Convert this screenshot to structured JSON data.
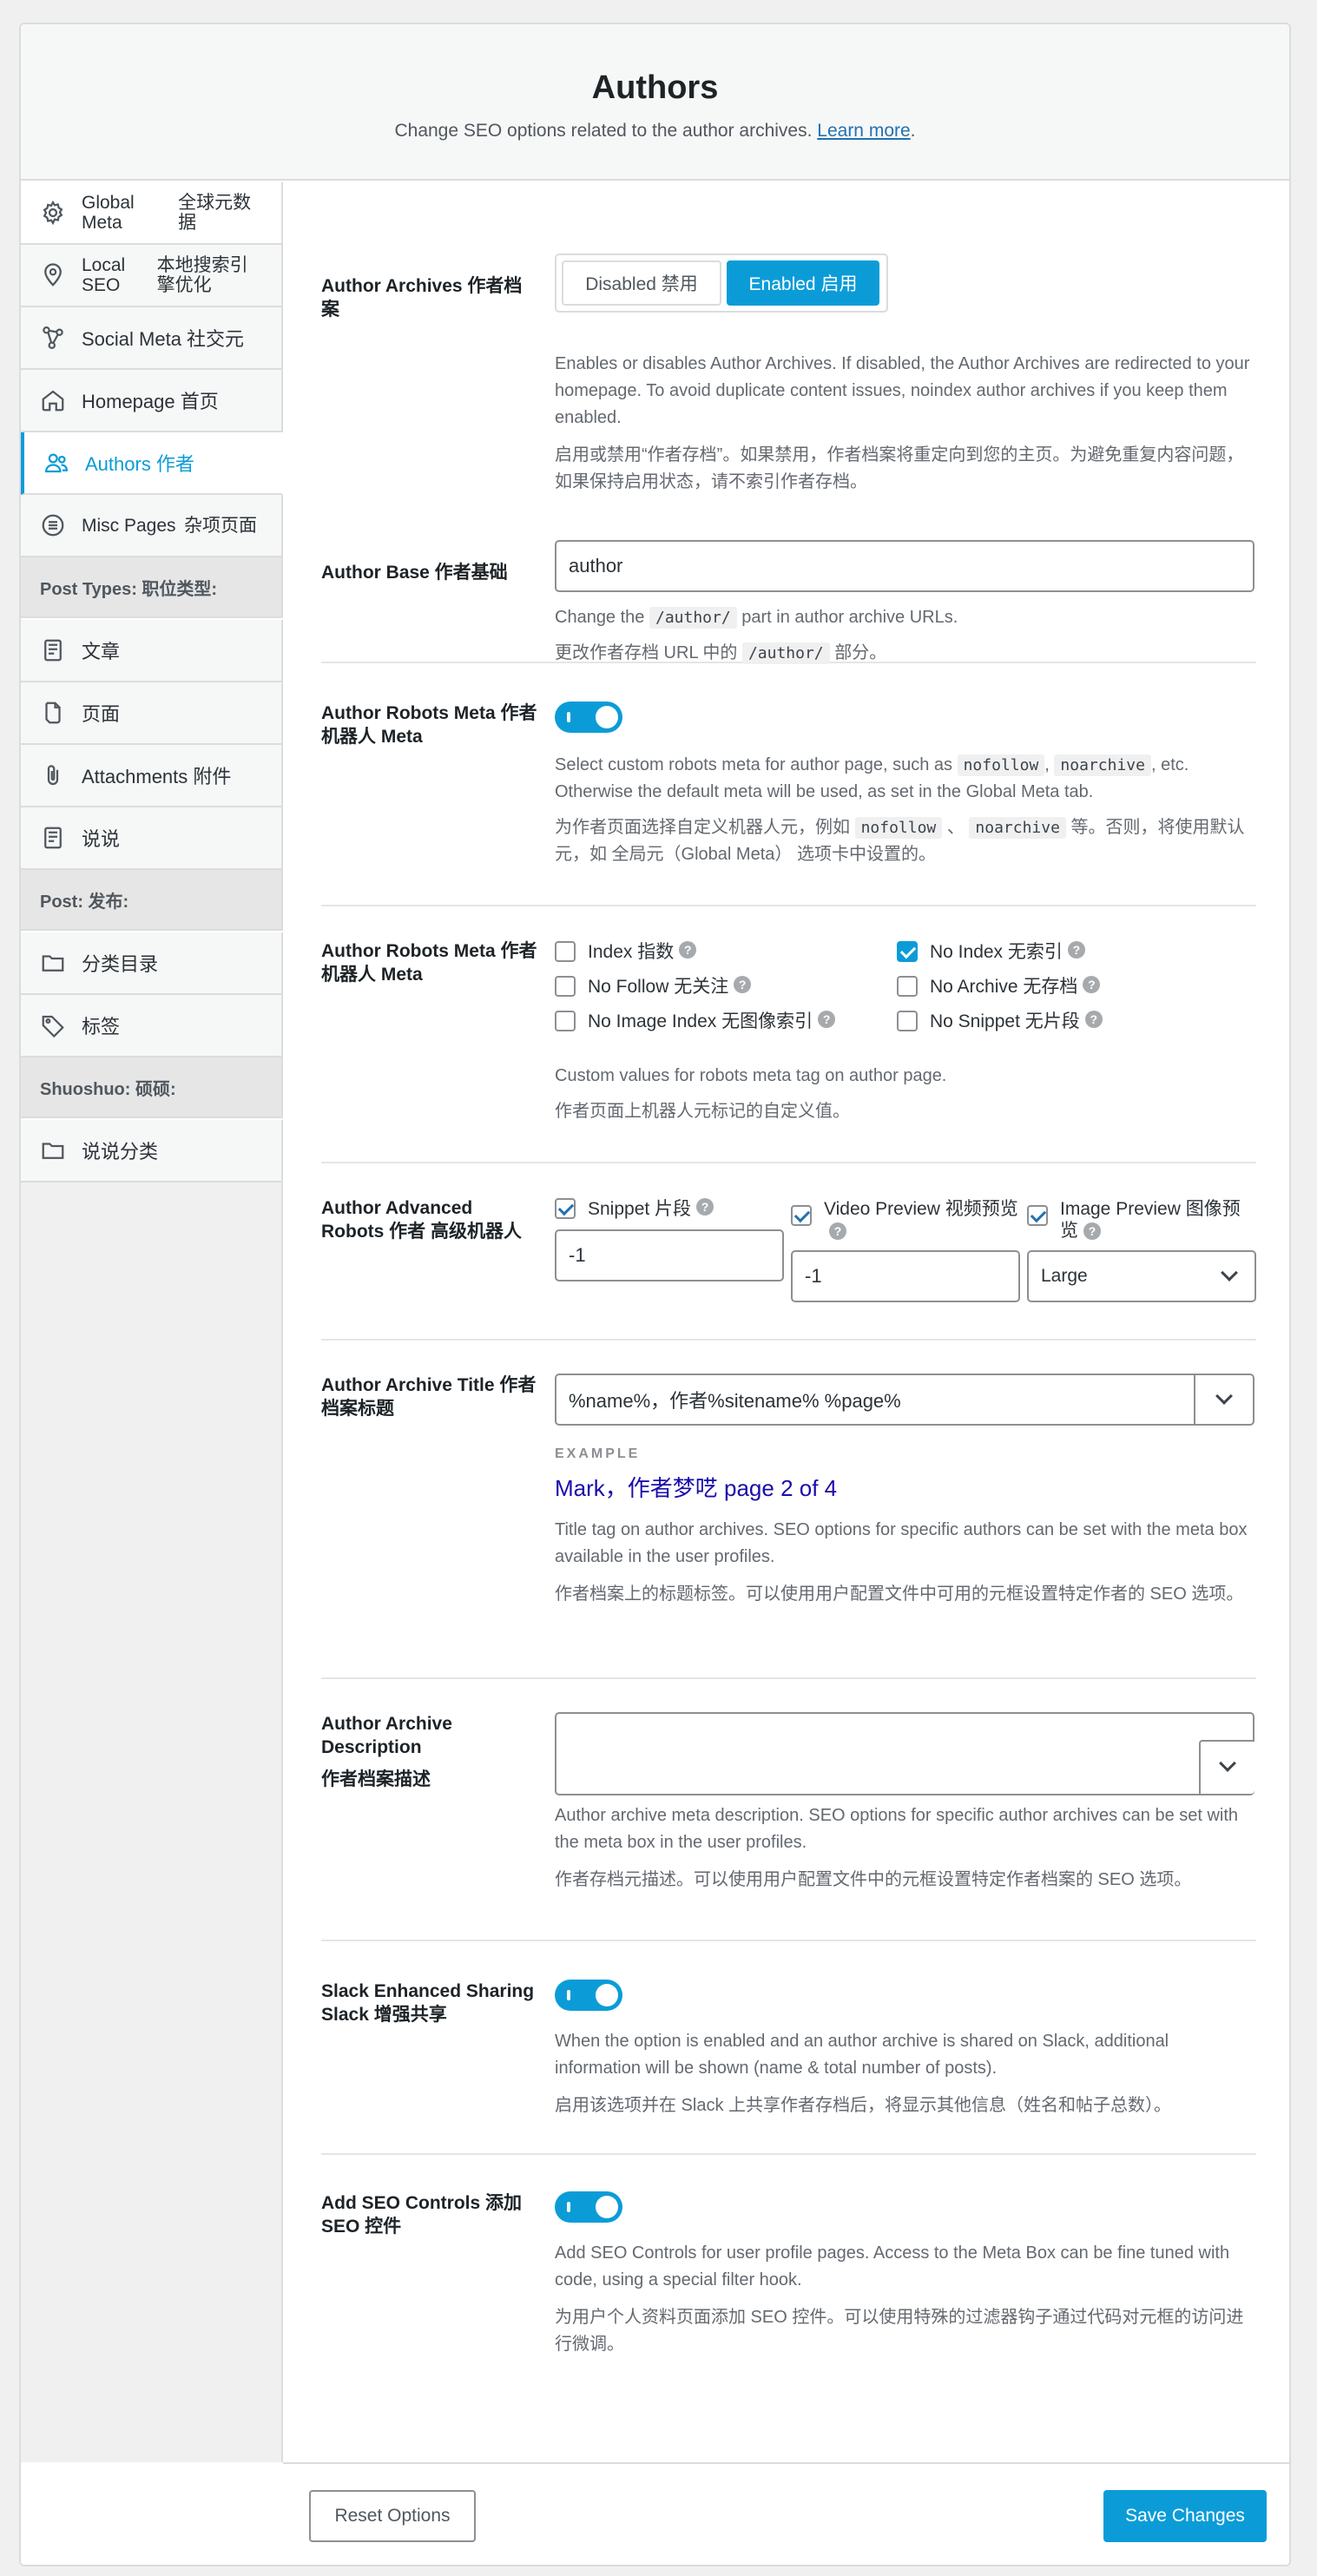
{
  "header": {
    "title": "Authors",
    "subtitle": "Change SEO options related to the author archives.",
    "learn_more": "Learn more",
    "period": "."
  },
  "nav": {
    "global_meta": [
      "Global Meta",
      "全球元数据"
    ],
    "local_seo": [
      "Local SEO",
      "本地搜索引擎优化"
    ],
    "social_meta": "Social Meta  社交元",
    "homepage": "Homepage  首页",
    "authors": "Authors  作者",
    "misc_pages": [
      "Misc Pages",
      "杂项页面"
    ],
    "post_types_header": "Post Types:  职位类型:",
    "articles": "文章",
    "pages": "页面",
    "attachments": "Attachments  附件",
    "shuoshuo": "说说",
    "post_header": "Post:  发布:",
    "categories": "分类目录",
    "tags": "标签",
    "shuoshuo_header": "Shuoshuo:  硕硕:",
    "shuoshuo_categories": "说说分类"
  },
  "archives": {
    "label": "Author Archives  作者档案",
    "disabled": "Disabled  禁用",
    "enabled": "Enabled  启用",
    "desc_en": "Enables or disables Author Archives. If disabled, the Author Archives are redirected to your homepage. To avoid duplicate content issues, noindex author archives if you keep them enabled.",
    "desc_zh": "启用或禁用“作者存档”。如果禁用，作者档案将重定向到您的主页。为避免重复内容问题，如果保持启用状态，请不索引作者存档。"
  },
  "base": {
    "label": "Author Base  作者基础",
    "value": "author",
    "desc_en_pre": "Change the",
    "code": "/author/",
    "desc_en_post": "part in author archive URLs.",
    "desc_zh_pre": "更改作者存档 URL 中的",
    "desc_zh_post": "部分。"
  },
  "robots_toggle": {
    "label": "Author Robots Meta  作者 机器人 Meta",
    "enabled": true,
    "desc_en_pre": "Select custom robots meta for author page, such as",
    "code1": "nofollow",
    "comma": ",",
    "code2": "noarchive",
    "desc_en_post": ", etc. Otherwise the default meta will be used, as set in the Global Meta tab.",
    "desc_zh_pre": "为作者页面选择自定义机器人元，例如",
    "sep": "、",
    "desc_zh_post": "等。否则，将使用默认元，如 全局元（Global Meta） 选项卡中设置的。"
  },
  "robots_checks": {
    "label": "Author Robots Meta  作者 机器人 Meta",
    "items": [
      {
        "label": "Index  指数",
        "checked": false
      },
      {
        "label": "No Index  无索引",
        "checked": true
      },
      {
        "label": "No Follow  无关注",
        "checked": false
      },
      {
        "label": "No Archive  无存档",
        "checked": false
      },
      {
        "label": "No Image Index  无图像索引",
        "checked": false
      },
      {
        "label": "No Snippet  无片段",
        "checked": false
      }
    ],
    "help": "?",
    "desc_en": "Custom values for robots meta tag on author page.",
    "desc_zh": "作者页面上机器人元标记的自定义值。"
  },
  "advanced": {
    "label": "Author Advanced Robots  作者 高级机器人",
    "snippet_label": "Snippet  片段",
    "snippet_value": "-1",
    "video_label": "Video Preview  视频预览",
    "video_value": "-1",
    "image_label": "Image Preview  图像预览",
    "image_value": "Large"
  },
  "title": {
    "label": "Author Archive Title 作者档案标题",
    "value": "%name%，作者%sitename% %page%",
    "example_label": "EXAMPLE",
    "example_value": "Mark，作者梦呓 page 2 of 4",
    "desc_en": "Title tag on author archives. SEO options for specific authors can be set with the meta box available in the user profiles.",
    "desc_zh": "作者档案上的标题标签。可以使用用户配置文件中可用的元框设置特定作者的 SEO 选项。"
  },
  "description": {
    "label_en": "Author Archive Description",
    "label_zh": "作者档案描述",
    "value": "",
    "desc_en": "Author archive meta description. SEO options for specific author archives can be set with the meta box in the user profiles.",
    "desc_zh": "作者存档元描述。可以使用用户配置文件中的元框设置特定作者档案的 SEO 选项。"
  },
  "slack": {
    "label": "Slack Enhanced Sharing  Slack 增强共享",
    "enabled": true,
    "desc_en": "When the option is enabled and an author archive is shared on Slack, additional information will be shown (name & total number of posts).",
    "desc_zh": "启用该选项并在 Slack 上共享作者存档后，将显示其他信息（姓名和帖子总数）。"
  },
  "seo_controls": {
    "label": "Add SEO Controls  添加 SEO 控件",
    "enabled": true,
    "desc_en": "Add SEO Controls for user profile pages. Access to the Meta Box can be fine tuned with code, using a special filter hook.",
    "desc_zh": "为用户个人资料页面添加 SEO 控件。可以使用特殊的过滤器钩子通过代码对元框的访问进行微调。"
  },
  "footer": {
    "reset": "Reset Options",
    "save": "Save Changes"
  },
  "colors": {
    "accent": "#0b9cd8",
    "example_link": "#1a0dab"
  }
}
